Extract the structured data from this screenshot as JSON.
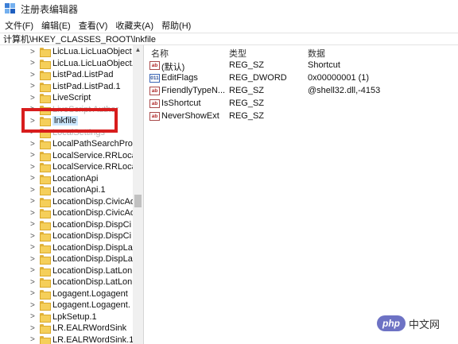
{
  "window": {
    "title": "注册表编辑器"
  },
  "menu": [
    "文件(F)",
    "编辑(E)",
    "查看(V)",
    "收藏夹(A)",
    "帮助(H)"
  ],
  "address": "计算机\\HKEY_CLASSES_ROOT\\lnkfile",
  "tree": {
    "items": [
      "LicLua.LicLuaObject",
      "LicLua.LicLuaObject.",
      "ListPad.ListPad",
      "ListPad.ListPad.1",
      "LiveScript",
      "LiveScript Author",
      "lnkfile",
      "LocalSettings",
      "LocalPathSearchProv",
      "LocalService.RRLoca",
      "LocalService.RRLoca",
      "LocationApi",
      "LocationApi.1",
      "LocationDisp.CivicAd",
      "LocationDisp.CivicAd",
      "LocationDisp.DispCi",
      "LocationDisp.DispCi",
      "LocationDisp.DispLa",
      "LocationDisp.DispLa",
      "LocationDisp.LatLon",
      "LocationDisp.LatLon",
      "Logagent.Logagent",
      "Logagent.Logagent.",
      "LpkSetup.1",
      "LR.EALRWordSink",
      "LR.EALRWordSink.1"
    ],
    "selected": "lnkfile"
  },
  "list": {
    "headers": {
      "name": "名称",
      "type": "类型",
      "data": "数据"
    },
    "rows": [
      {
        "icon": "ab",
        "name": "(默认)",
        "type": "REG_SZ",
        "data": "Shortcut"
      },
      {
        "icon": "dword",
        "name": "EditFlags",
        "type": "REG_DWORD",
        "data": "0x00000001 (1)"
      },
      {
        "icon": "ab",
        "name": "FriendlyTypeN...",
        "type": "REG_SZ",
        "data": "@shell32.dll,-4153"
      },
      {
        "icon": "ab",
        "name": "IsShortcut",
        "type": "REG_SZ",
        "data": ""
      },
      {
        "icon": "ab",
        "name": "NeverShowExt",
        "type": "REG_SZ",
        "data": ""
      }
    ]
  },
  "watermark": {
    "badge": "php",
    "text": "中文网"
  }
}
